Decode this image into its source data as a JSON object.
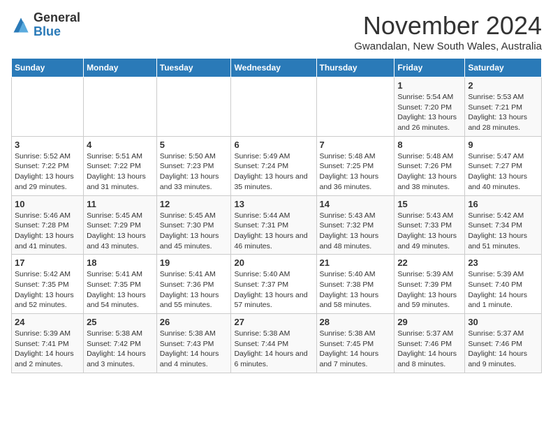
{
  "header": {
    "logo_general": "General",
    "logo_blue": "Blue",
    "month_title": "November 2024",
    "subtitle": "Gwandalan, New South Wales, Australia"
  },
  "days_of_week": [
    "Sunday",
    "Monday",
    "Tuesday",
    "Wednesday",
    "Thursday",
    "Friday",
    "Saturday"
  ],
  "weeks": [
    [
      {
        "day": "",
        "info": ""
      },
      {
        "day": "",
        "info": ""
      },
      {
        "day": "",
        "info": ""
      },
      {
        "day": "",
        "info": ""
      },
      {
        "day": "",
        "info": ""
      },
      {
        "day": "1",
        "info": "Sunrise: 5:54 AM\nSunset: 7:20 PM\nDaylight: 13 hours and 26 minutes."
      },
      {
        "day": "2",
        "info": "Sunrise: 5:53 AM\nSunset: 7:21 PM\nDaylight: 13 hours and 28 minutes."
      }
    ],
    [
      {
        "day": "3",
        "info": "Sunrise: 5:52 AM\nSunset: 7:22 PM\nDaylight: 13 hours and 29 minutes."
      },
      {
        "day": "4",
        "info": "Sunrise: 5:51 AM\nSunset: 7:22 PM\nDaylight: 13 hours and 31 minutes."
      },
      {
        "day": "5",
        "info": "Sunrise: 5:50 AM\nSunset: 7:23 PM\nDaylight: 13 hours and 33 minutes."
      },
      {
        "day": "6",
        "info": "Sunrise: 5:49 AM\nSunset: 7:24 PM\nDaylight: 13 hours and 35 minutes."
      },
      {
        "day": "7",
        "info": "Sunrise: 5:48 AM\nSunset: 7:25 PM\nDaylight: 13 hours and 36 minutes."
      },
      {
        "day": "8",
        "info": "Sunrise: 5:48 AM\nSunset: 7:26 PM\nDaylight: 13 hours and 38 minutes."
      },
      {
        "day": "9",
        "info": "Sunrise: 5:47 AM\nSunset: 7:27 PM\nDaylight: 13 hours and 40 minutes."
      }
    ],
    [
      {
        "day": "10",
        "info": "Sunrise: 5:46 AM\nSunset: 7:28 PM\nDaylight: 13 hours and 41 minutes."
      },
      {
        "day": "11",
        "info": "Sunrise: 5:45 AM\nSunset: 7:29 PM\nDaylight: 13 hours and 43 minutes."
      },
      {
        "day": "12",
        "info": "Sunrise: 5:45 AM\nSunset: 7:30 PM\nDaylight: 13 hours and 45 minutes."
      },
      {
        "day": "13",
        "info": "Sunrise: 5:44 AM\nSunset: 7:31 PM\nDaylight: 13 hours and 46 minutes."
      },
      {
        "day": "14",
        "info": "Sunrise: 5:43 AM\nSunset: 7:32 PM\nDaylight: 13 hours and 48 minutes."
      },
      {
        "day": "15",
        "info": "Sunrise: 5:43 AM\nSunset: 7:33 PM\nDaylight: 13 hours and 49 minutes."
      },
      {
        "day": "16",
        "info": "Sunrise: 5:42 AM\nSunset: 7:34 PM\nDaylight: 13 hours and 51 minutes."
      }
    ],
    [
      {
        "day": "17",
        "info": "Sunrise: 5:42 AM\nSunset: 7:35 PM\nDaylight: 13 hours and 52 minutes."
      },
      {
        "day": "18",
        "info": "Sunrise: 5:41 AM\nSunset: 7:35 PM\nDaylight: 13 hours and 54 minutes."
      },
      {
        "day": "19",
        "info": "Sunrise: 5:41 AM\nSunset: 7:36 PM\nDaylight: 13 hours and 55 minutes."
      },
      {
        "day": "20",
        "info": "Sunrise: 5:40 AM\nSunset: 7:37 PM\nDaylight: 13 hours and 57 minutes."
      },
      {
        "day": "21",
        "info": "Sunrise: 5:40 AM\nSunset: 7:38 PM\nDaylight: 13 hours and 58 minutes."
      },
      {
        "day": "22",
        "info": "Sunrise: 5:39 AM\nSunset: 7:39 PM\nDaylight: 13 hours and 59 minutes."
      },
      {
        "day": "23",
        "info": "Sunrise: 5:39 AM\nSunset: 7:40 PM\nDaylight: 14 hours and 1 minute."
      }
    ],
    [
      {
        "day": "24",
        "info": "Sunrise: 5:39 AM\nSunset: 7:41 PM\nDaylight: 14 hours and 2 minutes."
      },
      {
        "day": "25",
        "info": "Sunrise: 5:38 AM\nSunset: 7:42 PM\nDaylight: 14 hours and 3 minutes."
      },
      {
        "day": "26",
        "info": "Sunrise: 5:38 AM\nSunset: 7:43 PM\nDaylight: 14 hours and 4 minutes."
      },
      {
        "day": "27",
        "info": "Sunrise: 5:38 AM\nSunset: 7:44 PM\nDaylight: 14 hours and 6 minutes."
      },
      {
        "day": "28",
        "info": "Sunrise: 5:38 AM\nSunset: 7:45 PM\nDaylight: 14 hours and 7 minutes."
      },
      {
        "day": "29",
        "info": "Sunrise: 5:37 AM\nSunset: 7:46 PM\nDaylight: 14 hours and 8 minutes."
      },
      {
        "day": "30",
        "info": "Sunrise: 5:37 AM\nSunset: 7:46 PM\nDaylight: 14 hours and 9 minutes."
      }
    ]
  ]
}
